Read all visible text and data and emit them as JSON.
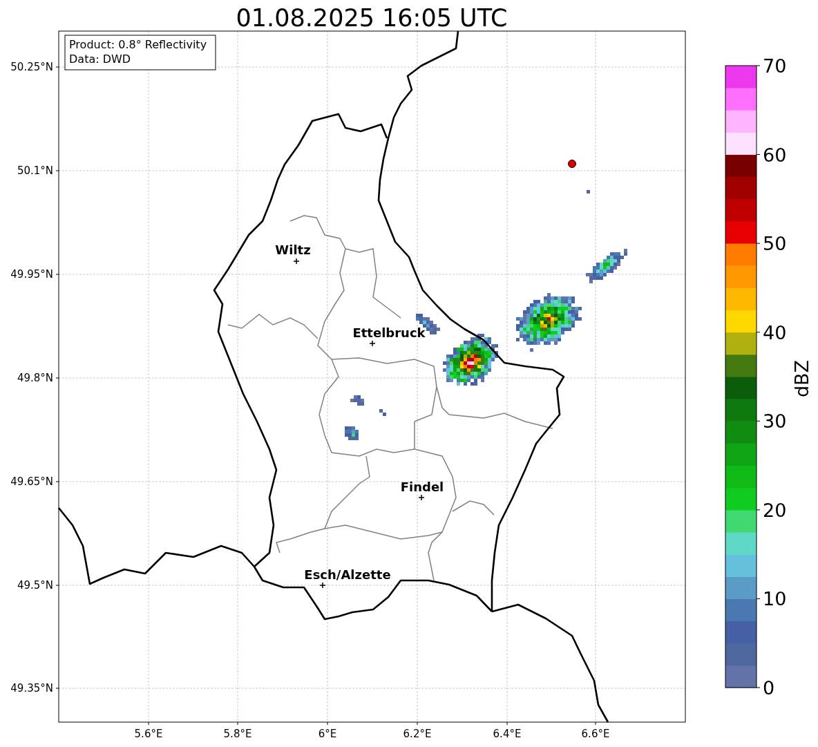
{
  "title": "01.08.2025 16:05 UTC",
  "legend": [
    "Product: 0.8° Reflectivity",
    "Data: DWD"
  ],
  "y_ticks": [
    "50.25°N",
    "50.1°N",
    "49.95°N",
    "49.8°N",
    "49.65°N",
    "49.5°N",
    "49.35°N"
  ],
  "x_ticks": [
    "5.6°E",
    "5.8°E",
    "6°E",
    "6.2°E",
    "6.4°E",
    "6.6°E"
  ],
  "cities": [
    {
      "name": "Wiltz"
    },
    {
      "name": "Ettelbruck"
    },
    {
      "name": "Findel"
    },
    {
      "name": "Esch/Alzette"
    }
  ],
  "colorbar": {
    "label": "dBZ",
    "ticks": [
      "70",
      "60",
      "50",
      "40",
      "30",
      "20",
      "10",
      "0"
    ],
    "bins": [
      {
        "color": "#6373a8"
      },
      {
        "color": "#5068a0"
      },
      {
        "color": "#4560a5"
      },
      {
        "color": "#4a78b0"
      },
      {
        "color": "#5a9bc8"
      },
      {
        "color": "#65c0dc"
      },
      {
        "color": "#60d8c8"
      },
      {
        "color": "#40d870"
      },
      {
        "color": "#10cc20"
      },
      {
        "color": "#10bb18"
      },
      {
        "color": "#10a515"
      },
      {
        "color": "#108c10"
      },
      {
        "color": "#0c7a0c"
      },
      {
        "color": "#0a5e0a"
      },
      {
        "color": "#457a10"
      },
      {
        "color": "#b0b010"
      },
      {
        "color": "#ffd800"
      },
      {
        "color": "#ffb800"
      },
      {
        "color": "#ff9800"
      },
      {
        "color": "#ff7c00"
      },
      {
        "color": "#e80000"
      },
      {
        "color": "#c00000"
      },
      {
        "color": "#a00000"
      },
      {
        "color": "#780000"
      },
      {
        "color": "#ffe0ff"
      },
      {
        "color": "#ffb4ff"
      },
      {
        "color": "#ff70ff"
      },
      {
        "color": "#ee38ee"
      }
    ]
  }
}
